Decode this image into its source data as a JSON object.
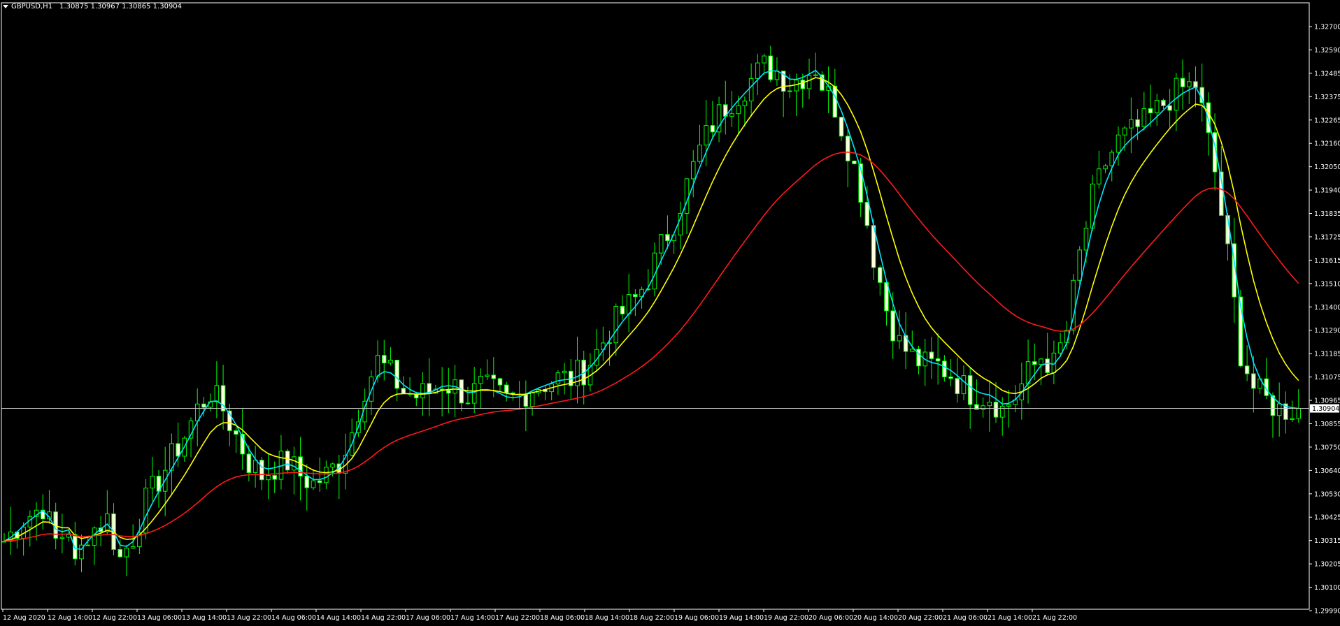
{
  "header": {
    "symbol": "GBPUSD,H1",
    "ohlc": "1.30875 1.30967 1.30865 1.30904"
  },
  "colors": {
    "background": "#000000",
    "axis": "#ffffff",
    "candle": "#00ff00",
    "candle_up_body": "#000000",
    "candle_down_body": "#ffffe0",
    "ma_fast": "#00e5ff",
    "ma_mid": "#ffff00",
    "ma_slow": "#ff1a1a",
    "price_line": "#c8c8c8"
  },
  "chart_data": {
    "type": "candlestick",
    "ylim": [
      1.2999,
      1.3275
    ],
    "y_ticks": [
      "1.32700",
      "1.32590",
      "1.32485",
      "1.32375",
      "1.32265",
      "1.32160",
      "1.32050",
      "1.31940",
      "1.31835",
      "1.31725",
      "1.31615",
      "1.31510",
      "1.31400",
      "1.31290",
      "1.31185",
      "1.31075",
      "1.30965",
      "1.30855",
      "1.30750",
      "1.30640",
      "1.30530",
      "1.30425",
      "1.30315",
      "1.30205",
      "1.30100",
      "1.29990"
    ],
    "x_ticks": [
      "12 Aug 2020",
      "12 Aug 14:00",
      "12 Aug 22:00",
      "13 Aug 06:00",
      "13 Aug 14:00",
      "13 Aug 22:00",
      "14 Aug 06:00",
      "14 Aug 14:00",
      "14 Aug 22:00",
      "17 Aug 06:00",
      "17 Aug 14:00",
      "17 Aug 22:00",
      "18 Aug 06:00",
      "18 Aug 14:00",
      "18 Aug 22:00",
      "19 Aug 06:00",
      "19 Aug 14:00",
      "19 Aug 22:00",
      "20 Aug 06:00",
      "20 Aug 14:00",
      "20 Aug 22:00",
      "21 Aug 06:00",
      "21 Aug 14:00",
      "21 Aug 22:00"
    ],
    "current_price": "1.30904",
    "current_price_value": 1.30904,
    "close_path": [
      [
        0,
        1.303
      ],
      [
        3,
        1.304
      ],
      [
        6,
        1.3046
      ],
      [
        8,
        1.303
      ],
      [
        10,
        1.3036
      ],
      [
        11,
        1.3018
      ],
      [
        13,
        1.3034
      ],
      [
        16,
        1.304
      ],
      [
        18,
        1.3022
      ],
      [
        20,
        1.3032
      ],
      [
        22,
        1.3048
      ],
      [
        24,
        1.3058
      ],
      [
        26,
        1.3068
      ],
      [
        28,
        1.3078
      ],
      [
        30,
        1.309
      ],
      [
        32,
        1.3098
      ],
      [
        34,
        1.309
      ],
      [
        36,
        1.3078
      ],
      [
        38,
        1.3066
      ],
      [
        40,
        1.306
      ],
      [
        42,
        1.3064
      ],
      [
        44,
        1.3066
      ],
      [
        46,
        1.306
      ],
      [
        48,
        1.3056
      ],
      [
        50,
        1.306
      ],
      [
        52,
        1.3066
      ],
      [
        54,
        1.308
      ],
      [
        56,
        1.31
      ],
      [
        58,
        1.3112
      ],
      [
        60,
        1.3106
      ],
      [
        62,
        1.3098
      ],
      [
        64,
        1.3096
      ],
      [
        66,
        1.3098
      ],
      [
        68,
        1.3102
      ],
      [
        70,
        1.31
      ],
      [
        72,
        1.3096
      ],
      [
        74,
        1.31
      ],
      [
        76,
        1.3098
      ],
      [
        78,
        1.3094
      ],
      [
        80,
        1.3096
      ],
      [
        82,
        1.31
      ],
      [
        84,
        1.3102
      ],
      [
        86,
        1.3104
      ],
      [
        88,
        1.3104
      ],
      [
        90,
        1.3108
      ],
      [
        92,
        1.3116
      ],
      [
        94,
        1.3126
      ],
      [
        96,
        1.3134
      ],
      [
        98,
        1.314
      ],
      [
        100,
        1.315
      ],
      [
        102,
        1.3164
      ],
      [
        104,
        1.3176
      ],
      [
        106,
        1.3192
      ],
      [
        108,
        1.3208
      ],
      [
        110,
        1.322
      ],
      [
        112,
        1.3228
      ],
      [
        114,
        1.3234
      ],
      [
        116,
        1.324
      ],
      [
        118,
        1.3246
      ],
      [
        120,
        1.3244
      ],
      [
        122,
        1.3238
      ],
      [
        124,
        1.3242
      ],
      [
        126,
        1.3246
      ],
      [
        127,
        1.3238
      ],
      [
        129,
        1.3228
      ],
      [
        131,
        1.321
      ],
      [
        133,
        1.319
      ],
      [
        135,
        1.316
      ],
      [
        137,
        1.3136
      ],
      [
        139,
        1.312
      ],
      [
        141,
        1.3114
      ],
      [
        143,
        1.311
      ],
      [
        145,
        1.311
      ],
      [
        147,
        1.3106
      ],
      [
        149,
        1.31
      ],
      [
        151,
        1.3096
      ],
      [
        153,
        1.3096
      ],
      [
        155,
        1.309
      ],
      [
        157,
        1.3096
      ],
      [
        159,
        1.3106
      ],
      [
        161,
        1.3114
      ],
      [
        163,
        1.311
      ],
      [
        165,
        1.3126
      ],
      [
        167,
        1.316
      ],
      [
        169,
        1.3186
      ],
      [
        171,
        1.3202
      ],
      [
        173,
        1.3212
      ],
      [
        175,
        1.3216
      ],
      [
        177,
        1.322
      ],
      [
        179,
        1.3226
      ],
      [
        181,
        1.3232
      ],
      [
        183,
        1.3236
      ],
      [
        185,
        1.3238
      ],
      [
        186,
        1.3226
      ],
      [
        188,
        1.3198
      ],
      [
        190,
        1.316
      ],
      [
        192,
        1.3116
      ],
      [
        194,
        1.31
      ],
      [
        196,
        1.3094
      ],
      [
        198,
        1.309
      ],
      [
        200,
        1.309
      ],
      [
        201,
        1.309
      ]
    ],
    "series": [
      {
        "name": "",
        "period": 3,
        "color_key": "ma_fast"
      },
      {
        "name": "",
        "period": 9,
        "color_key": "ma_mid"
      },
      {
        "name": "",
        "period": 36,
        "color_key": "ma_slow"
      }
    ]
  }
}
